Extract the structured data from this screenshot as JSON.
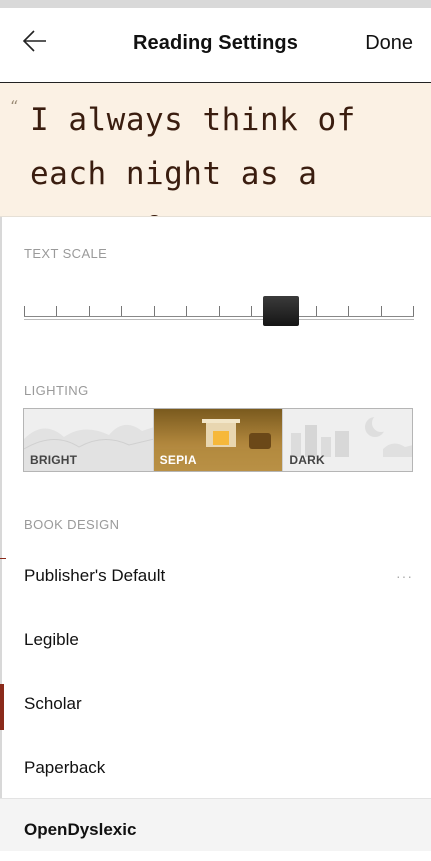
{
  "header": {
    "title": "Reading Settings",
    "done_label": "Done"
  },
  "preview": {
    "quote_mark": "“",
    "text": "I always think of each night as a song. Or"
  },
  "text_scale": {
    "label": "TEXT SCALE",
    "level": 0.66
  },
  "lighting": {
    "label": "LIGHTING",
    "options": [
      {
        "label": "BRIGHT",
        "selected": false
      },
      {
        "label": "SEPIA",
        "selected": true
      },
      {
        "label": "DARK",
        "selected": false
      }
    ]
  },
  "book_design": {
    "label": "BOOK DESIGN",
    "items": [
      {
        "label": "Publisher's Default",
        "more": "···"
      },
      {
        "label": "Legible"
      },
      {
        "label": "Scholar"
      },
      {
        "label": "Paperback"
      },
      {
        "label": "OpenDyslexic"
      }
    ]
  },
  "colors": {
    "sepia_background": "#fbf1e4",
    "sepia_text": "#3a1d0f"
  }
}
